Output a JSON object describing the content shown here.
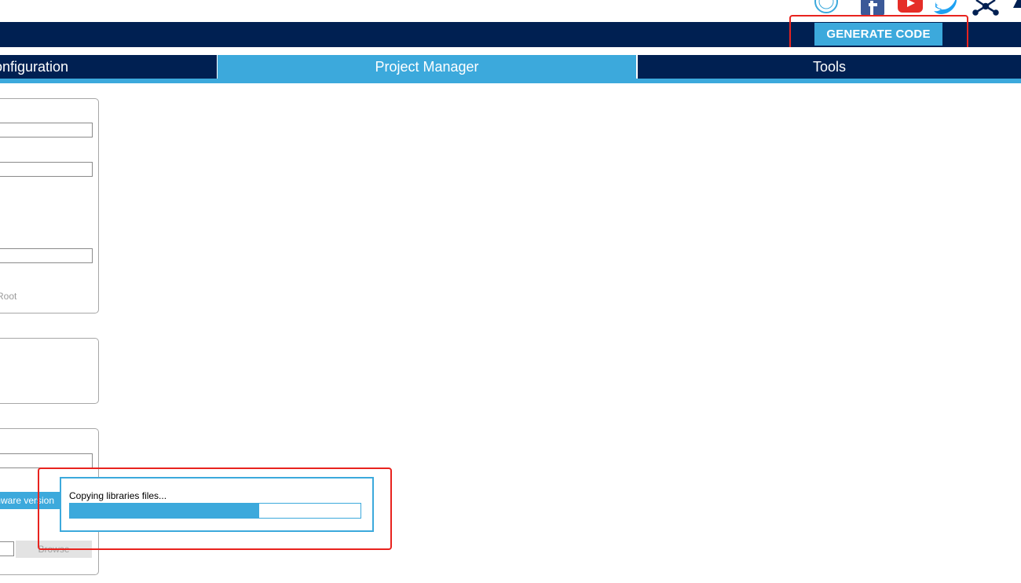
{
  "header": {
    "generate_label": "GENERATE CODE"
  },
  "tabs": [
    {
      "label": "onfiguration"
    },
    {
      "label": "Project Manager"
    },
    {
      "label": "Tools"
    }
  ],
  "panels": {
    "root_label": "Root",
    "firmware_button_label": "mware version",
    "browse_label": "Browse"
  },
  "progress": {
    "text": "Copying libraries files...",
    "fraction": 0.65
  },
  "colors": {
    "header_bg": "#002052",
    "accent": "#3ca9dc",
    "highlight": "#e8231e"
  },
  "icons": [
    "st-logo-icon",
    "facebook-icon",
    "youtube-icon",
    "twitter-icon",
    "network-icon",
    "st-arrow-icon"
  ]
}
